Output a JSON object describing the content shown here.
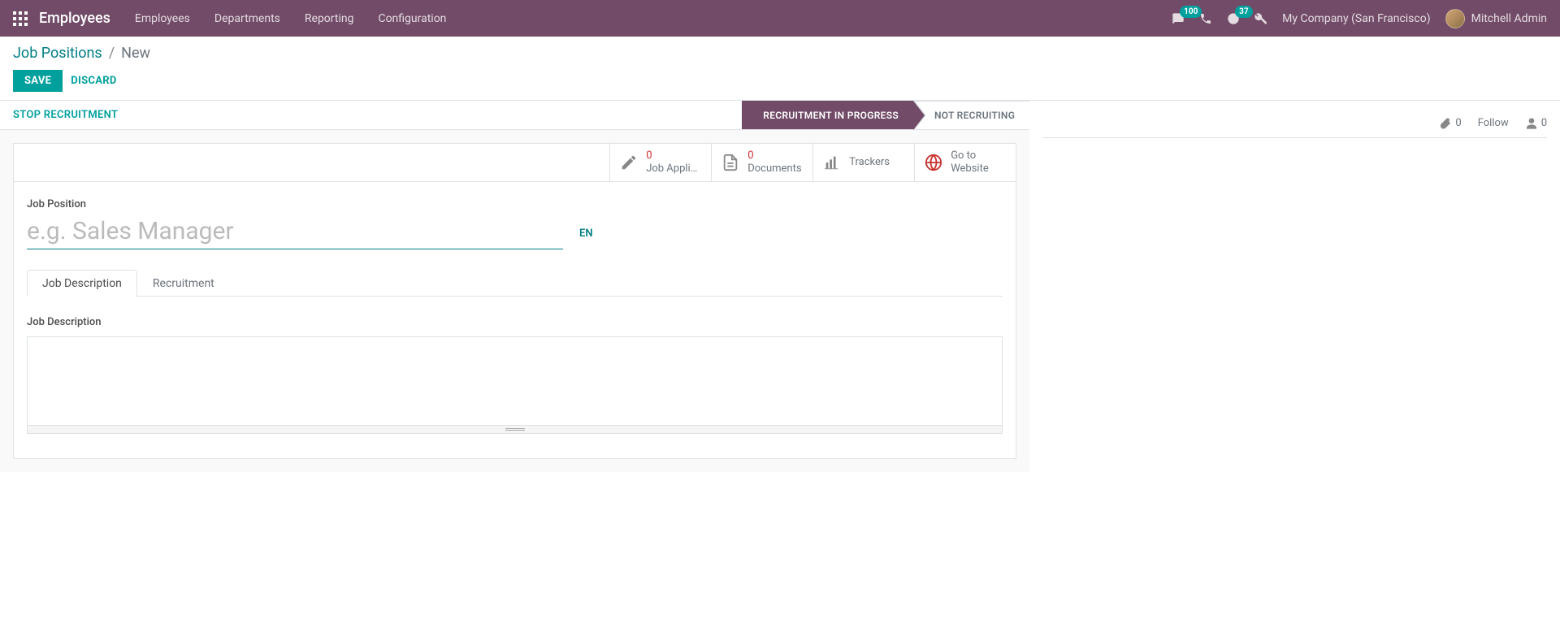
{
  "navbar": {
    "brand": "Employees",
    "menu": [
      "Employees",
      "Departments",
      "Reporting",
      "Configuration"
    ],
    "messages_badge": "100",
    "activities_badge": "37",
    "company": "My Company (San Francisco)",
    "user": "Mitchell Admin"
  },
  "breadcrumb": {
    "parent": "Job Positions",
    "current": "New"
  },
  "buttons": {
    "save": "SAVE",
    "discard": "DISCARD",
    "stop_recruitment": "STOP RECRUITMENT"
  },
  "status": {
    "active": "RECRUITMENT IN PROGRESS",
    "inactive": "NOT RECRUITING"
  },
  "side": {
    "attachments": "0",
    "follow": "Follow",
    "followers": "0"
  },
  "stat_buttons": {
    "applications": {
      "value": "0",
      "label": "Job Applic..."
    },
    "documents": {
      "value": "0",
      "label": "Documents"
    },
    "trackers": {
      "label": "Trackers"
    },
    "website": {
      "label_line1": "Go to",
      "label_line2": "Website"
    }
  },
  "form": {
    "position_label": "Job Position",
    "position_placeholder": "e.g. Sales Manager",
    "position_value": "",
    "lang": "EN",
    "tabs": {
      "active": "Job Description",
      "other": "Recruitment"
    },
    "description_label": "Job Description",
    "description_value": ""
  }
}
